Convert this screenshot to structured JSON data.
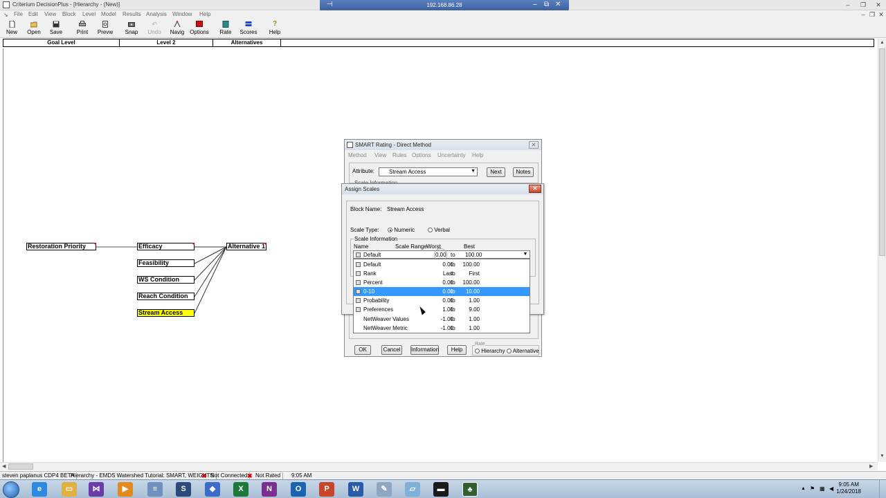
{
  "window": {
    "title": "Criterium DecisionPlus - [Hierarchy - (New)]",
    "rdp_host": "192.168.86.28"
  },
  "menu": [
    "File",
    "Edit",
    "View",
    "Block",
    "Level",
    "Model",
    "Results",
    "Analysis",
    "Window",
    "Help"
  ],
  "toolbar": [
    {
      "label": "New",
      "icon": "new-document-icon",
      "enabled": true
    },
    {
      "label": "Open",
      "icon": "open-folder-icon",
      "enabled": true
    },
    {
      "label": "Save",
      "icon": "save-disk-icon",
      "enabled": true
    },
    {
      "label": "Print",
      "icon": "printer-icon",
      "enabled": true
    },
    {
      "label": "Prevw",
      "icon": "print-preview-icon",
      "enabled": true
    },
    {
      "label": "Snap",
      "icon": "camera-icon",
      "enabled": true
    },
    {
      "label": "Undo",
      "icon": "undo-icon",
      "enabled": false
    },
    {
      "label": "Navig",
      "icon": "navigate-icon",
      "enabled": true
    },
    {
      "label": "Options",
      "icon": "options-icon",
      "enabled": true
    },
    {
      "label": "Rate",
      "icon": "rate-icon",
      "enabled": true
    },
    {
      "label": "Scores",
      "icon": "scores-icon",
      "enabled": true
    },
    {
      "label": "Help",
      "icon": "help-icon",
      "enabled": true
    }
  ],
  "levels": [
    "Goal Level",
    "Level 2",
    "Alternatives"
  ],
  "hierarchy": {
    "goal": "Restoration Priority",
    "criteria": [
      "Efficacy",
      "Feasibility",
      "WS Condition",
      "Reach Condition",
      "Stream Access"
    ],
    "selected_criterion": "Stream Access",
    "highlight_color": "#ffff00",
    "alternatives": [
      "Alternative 1"
    ]
  },
  "smart_dialog": {
    "title": "SMART Rating - Direct Method",
    "menu": [
      "Method",
      "View",
      "Rules",
      "Options",
      "Uncertainty",
      "Help"
    ],
    "attribute_label": "Attribute:",
    "attribute_value": "Stream Access",
    "next_label": "Next",
    "notes_label": "Notes",
    "scale_info_label": "Scale Information",
    "ok_label": "OK",
    "cancel_label": "Cancel",
    "information_label": "Information",
    "help_label": "Help",
    "rate_label": "Rate",
    "rate_options": [
      "Hierarchy",
      "Alternative"
    ]
  },
  "assign_dialog": {
    "title": "Assign Scales",
    "block_name_label": "Block Name:",
    "block_name_value": "Stream Access",
    "scale_type_label": "Scale Type:",
    "scale_types": [
      "Numeric",
      "Verbal"
    ],
    "selected_scale_type": "Numeric",
    "scale_info_label": "Scale Information",
    "columns": {
      "name": "Name",
      "range": "Scale Range",
      "worst": "Worst",
      "best": "Best"
    },
    "current": {
      "name": "Default",
      "worst": "0.00",
      "to": "to",
      "best": "100.00"
    },
    "options": [
      {
        "name": "Default",
        "worst": "0.00",
        "to": "to",
        "best": "100.00"
      },
      {
        "name": "Rank",
        "worst": "Last",
        "to": "to",
        "best": "First"
      },
      {
        "name": "Percent",
        "worst": "0.00",
        "to": "to",
        "best": "100.00"
      },
      {
        "name": "0-10",
        "worst": "0.00",
        "to": "to",
        "best": "10.00"
      },
      {
        "name": "Probability",
        "worst": "0.00",
        "to": "to",
        "best": "1.00"
      },
      {
        "name": "Preferences",
        "worst": "1.00",
        "to": "to",
        "best": "9.00"
      },
      {
        "name": "NetWeaver Values",
        "worst": "-1.00",
        "to": "to",
        "best": "1.00"
      },
      {
        "name": "NetWeaver Metric",
        "worst": "-1.00",
        "to": "to",
        "best": "1.00"
      }
    ],
    "highlighted_option": "0-10",
    "selection_color": "#3399ff"
  },
  "status": {
    "user": "steven paplanus CDP4 BETA",
    "doc": "Hierarchy - EMDS Watershed Tutorial: SMART, WEIGHTS",
    "connection": "Not Connected",
    "rated": "Not Rated",
    "time": "9:05 AM"
  },
  "taskbar": {
    "clock_time": "9:05 AM",
    "clock_date": "1/24/2018",
    "apps": [
      "internet-explorer-icon",
      "file-explorer-icon",
      "visual-studio-icon",
      "media-player-icon",
      "notepad-icon",
      "app-s-icon",
      "app-blue-icon",
      "excel-icon",
      "onenote-icon",
      "outlook-icon",
      "powerpoint-icon",
      "word-icon",
      "tools-icon",
      "remote-desktop-icon",
      "terminal-icon",
      "criterium-tree-icon"
    ]
  }
}
